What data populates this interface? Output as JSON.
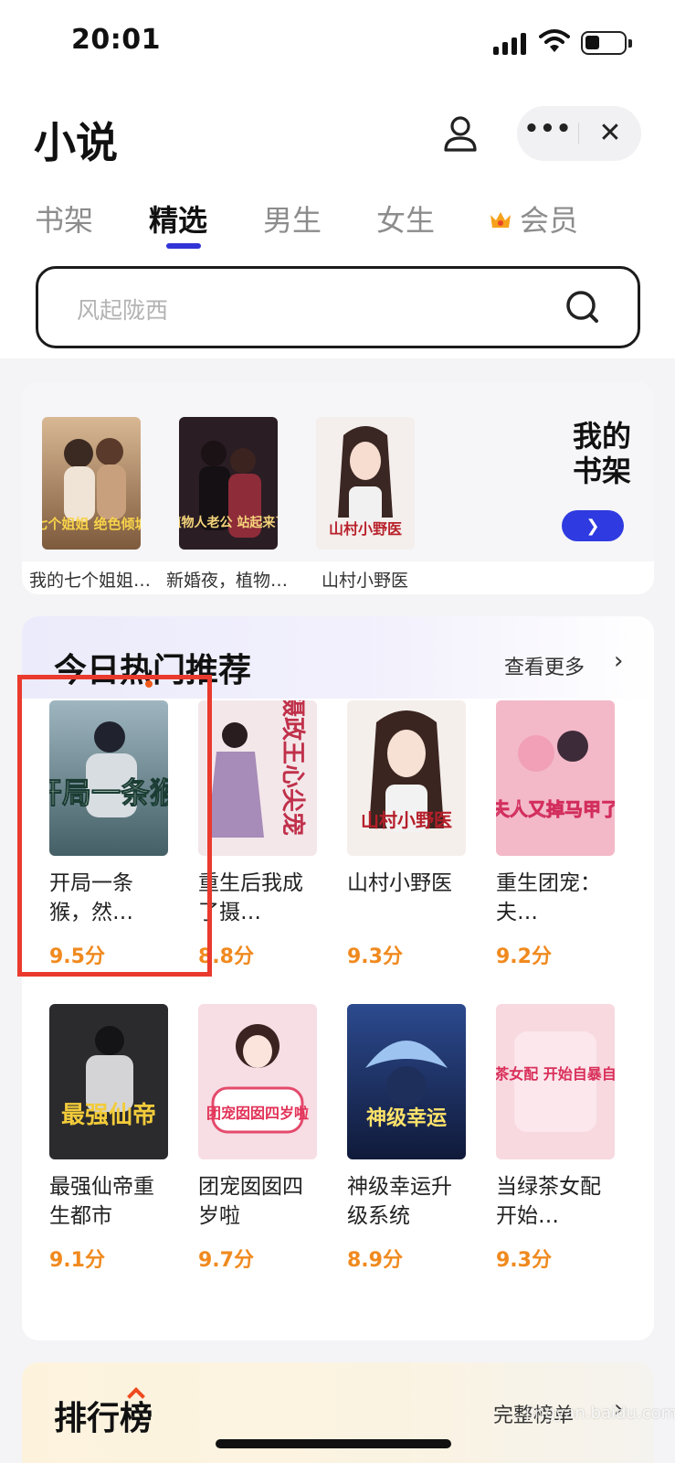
{
  "status": {
    "time": "20:01"
  },
  "header": {
    "title": "小说"
  },
  "tabs": [
    "书架",
    "精选",
    "男生",
    "女生",
    "会员"
  ],
  "active_tab": "精选",
  "search": {
    "placeholder": "风起陇西"
  },
  "shelf": {
    "title": "我的书架",
    "title_line1": "我的",
    "title_line2": "书架",
    "books": [
      {
        "name": "我的七个姐姐…",
        "cover_text": "七个姐姐 绝色倾城"
      },
      {
        "name": "新婚夜，植物…",
        "cover_text": "植物人老公 站起来了"
      },
      {
        "name": "山村小野医",
        "cover_text": "山村小野医"
      }
    ]
  },
  "hot": {
    "title": "今日热门推荐",
    "more": "查看更多",
    "books": [
      {
        "name": "开局一条猴，然…",
        "score": "9.5分",
        "cover_text": "开局一条猴"
      },
      {
        "name": "重生后我成了摄…",
        "score": "8.8分",
        "cover_text": "摄政王心尖宠"
      },
      {
        "name": "山村小野医",
        "score": "9.3分",
        "cover_text": "山村小野医"
      },
      {
        "name": "重生团宠：夫…",
        "score": "9.2分",
        "cover_text": "夫人又掉马甲了"
      },
      {
        "name": "最强仙帝重生都市",
        "score": "9.1分",
        "cover_text": "最强仙帝"
      },
      {
        "name": "团宠囡囡四岁啦",
        "score": "9.7分",
        "cover_text": "团宠囡囡四岁啦"
      },
      {
        "name": "神级幸运升级系统",
        "score": "8.9分",
        "cover_text": "神级幸运"
      },
      {
        "name": "当绿茶女配开始…",
        "score": "9.3分",
        "cover_text": "绿茶女配 开始自暴自弃"
      }
    ]
  },
  "rank": {
    "title": "排行榜",
    "more": "完整榜单"
  },
  "watermark": "jingyan.baidu.com",
  "colors": {
    "accent": "#3235d6",
    "score": "#f08a1f",
    "highlight": "#ea3a2e"
  }
}
